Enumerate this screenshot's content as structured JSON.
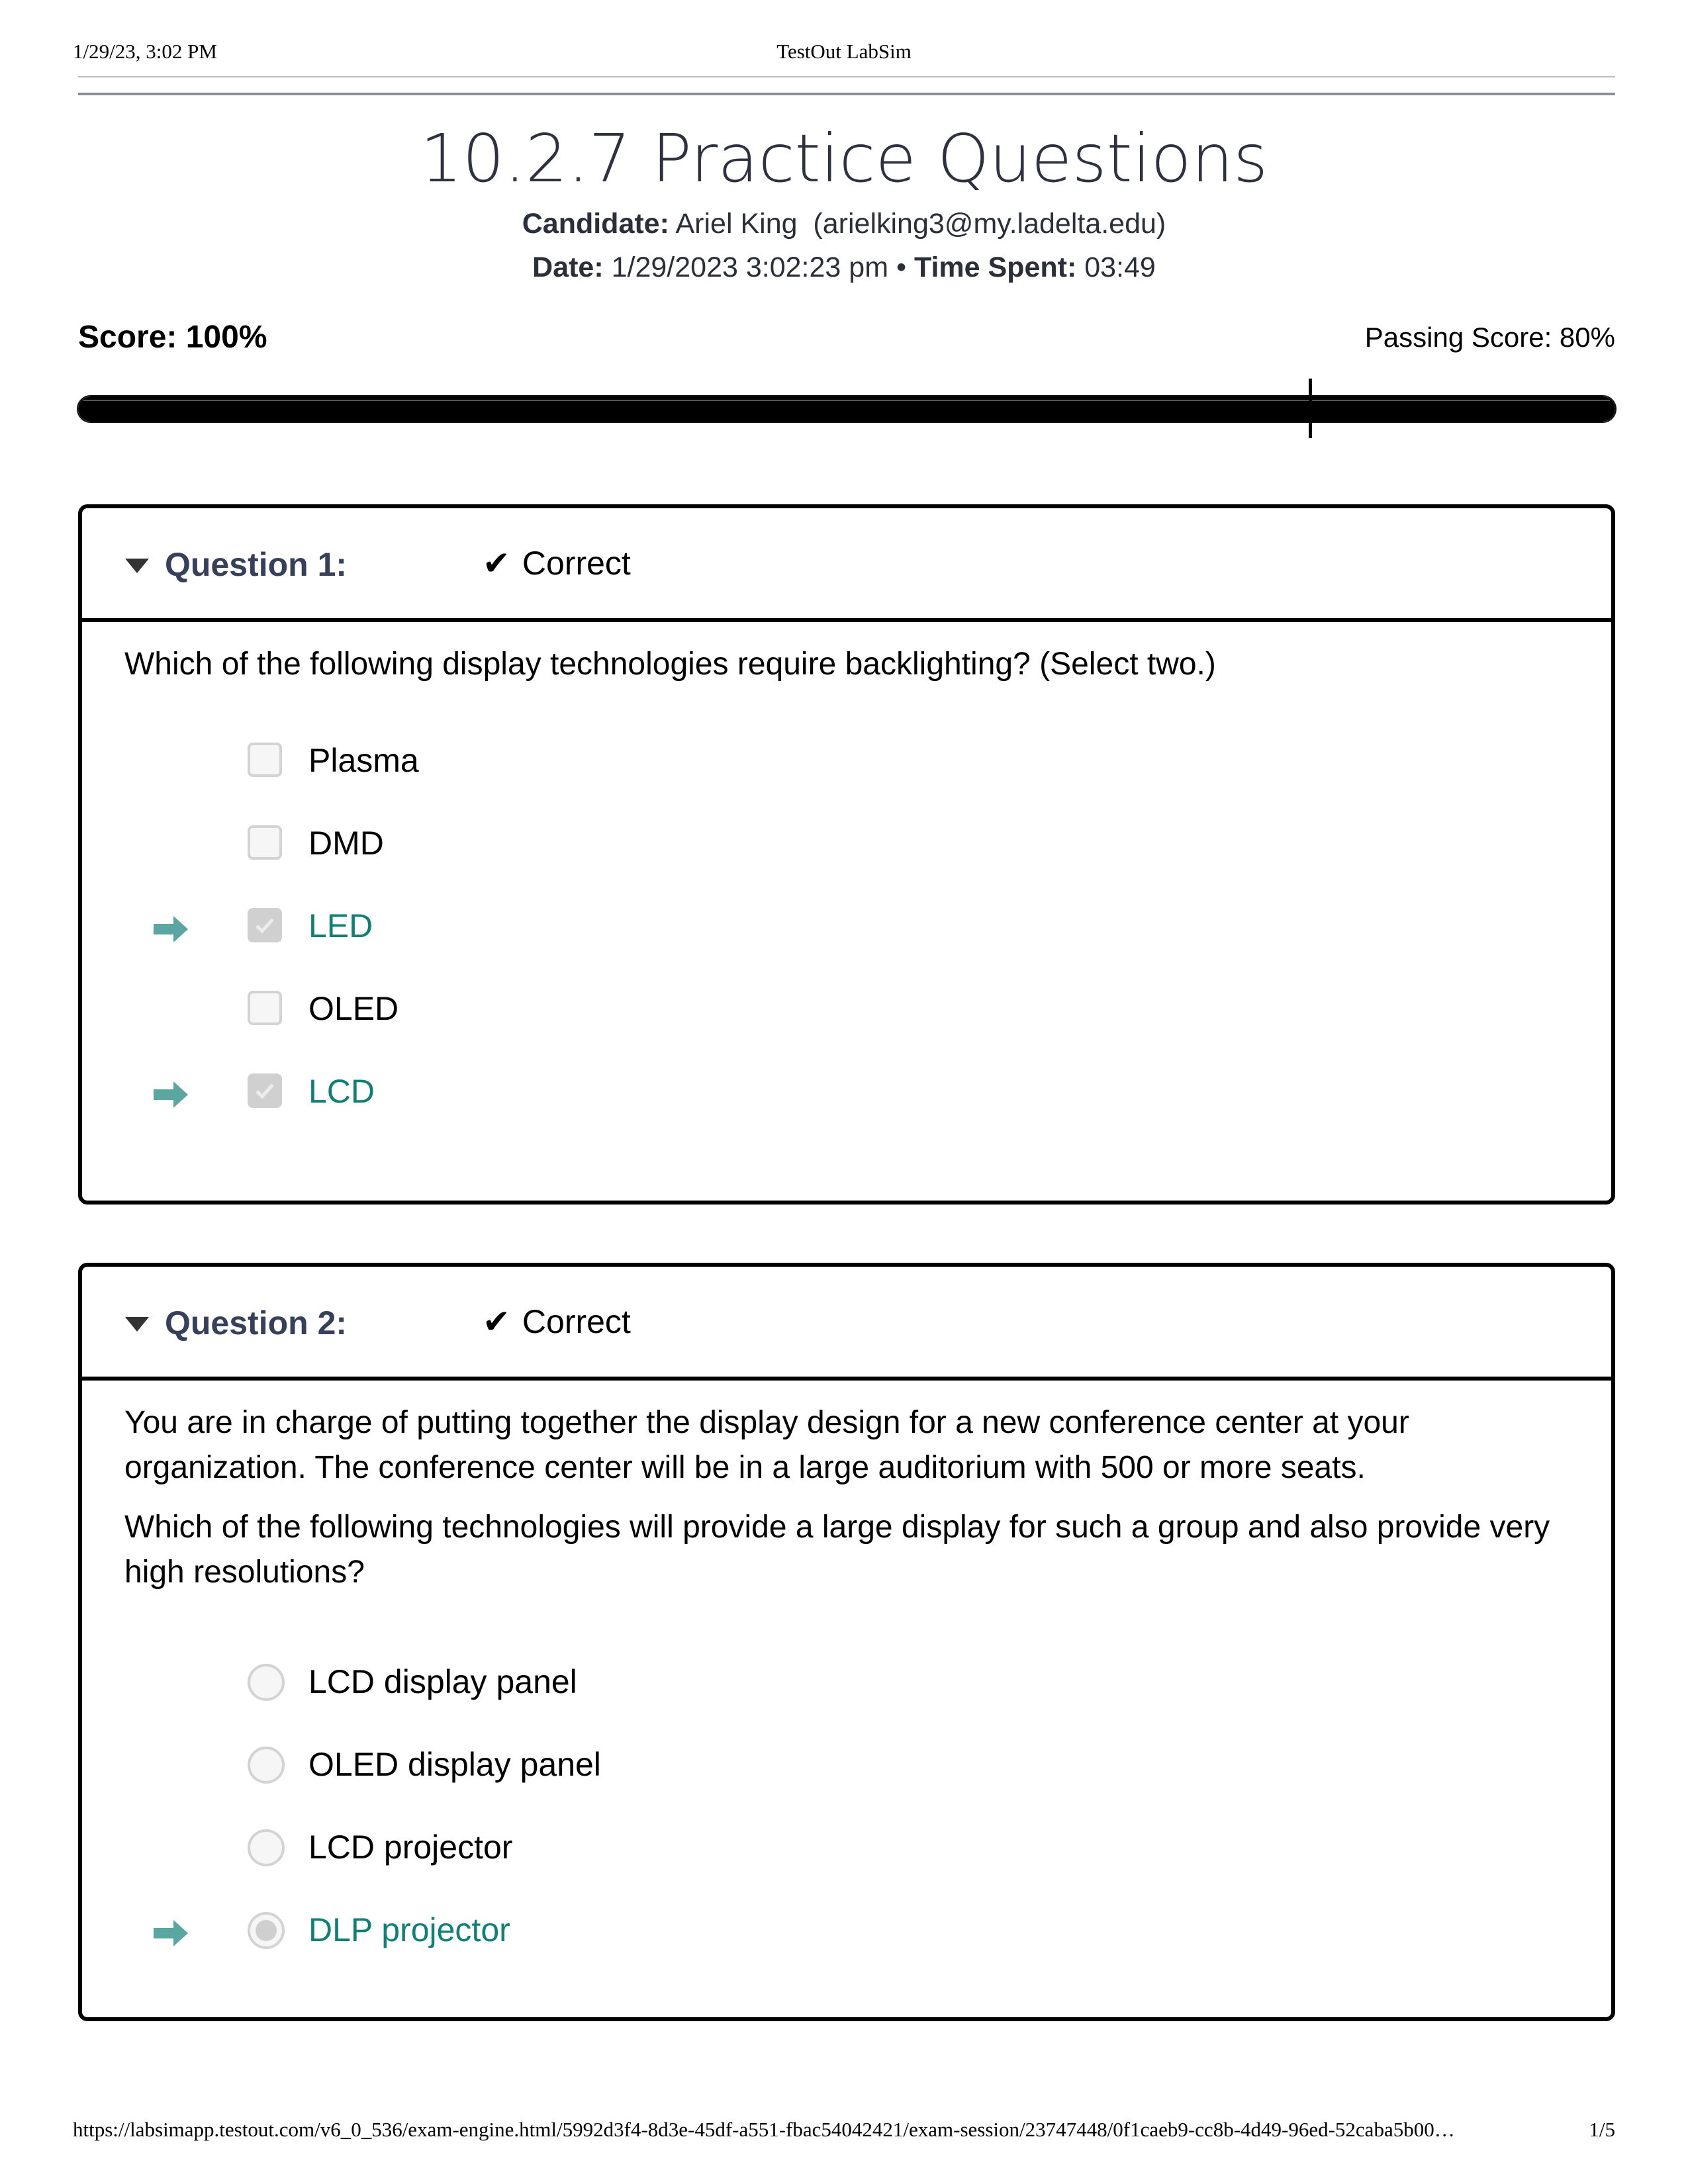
{
  "print_header": {
    "datetime": "1/29/23, 3:02 PM",
    "title": "TestOut LabSim"
  },
  "header": {
    "title": "10.2.7 Practice Questions",
    "candidate_label": "Candidate:",
    "candidate_value": " Ariel King  (arielking3@my.ladelta.edu)",
    "date_label": "Date:",
    "date_value": " 1/29/2023 3:02:23 pm • ",
    "time_label": "Time Spent:",
    "time_value": " 03:49"
  },
  "score": {
    "label": "Score: 100%",
    "value_percent": 100,
    "passing_label": "Passing Score: 80%",
    "passing_percent": 80
  },
  "colors": {
    "correct_answer": "#0e8075",
    "arrow": "#5aa6a0",
    "question_title": "#36405a"
  },
  "questions": [
    {
      "number_label": "Question 1:",
      "status_icon": "checkmark-icon",
      "status": "Correct",
      "text": [
        "Which of the following display technologies require backlighting? (Select two.)"
      ],
      "type": "checkbox",
      "options": [
        {
          "label": "Plasma",
          "selected": false,
          "correct": false
        },
        {
          "label": "DMD",
          "selected": false,
          "correct": false
        },
        {
          "label": "LED",
          "selected": true,
          "correct": true
        },
        {
          "label": "OLED",
          "selected": false,
          "correct": false
        },
        {
          "label": "LCD",
          "selected": true,
          "correct": true
        }
      ]
    },
    {
      "number_label": "Question 2:",
      "status_icon": "checkmark-icon",
      "status": "Correct",
      "text": [
        "You are in charge of putting together the display design for a new conference center at your organization. The conference center will be in a large auditorium with 500 or more seats.",
        "Which of the following technologies will provide a large display for such a group and also provide very high resolutions?"
      ],
      "type": "radio",
      "options": [
        {
          "label": "LCD display panel",
          "selected": false,
          "correct": false
        },
        {
          "label": "OLED display panel",
          "selected": false,
          "correct": false
        },
        {
          "label": "LCD projector",
          "selected": false,
          "correct": false
        },
        {
          "label": "DLP projector",
          "selected": true,
          "correct": true
        }
      ]
    }
  ],
  "print_footer": {
    "url": "https://labsimapp.testout.com/v6_0_536/exam-engine.html/5992d3f4-8d3e-45df-a551-fbac54042421/exam-session/23747448/0f1caeb9-cc8b-4d49-96ed-52caba5b00…",
    "page": "1/5"
  }
}
